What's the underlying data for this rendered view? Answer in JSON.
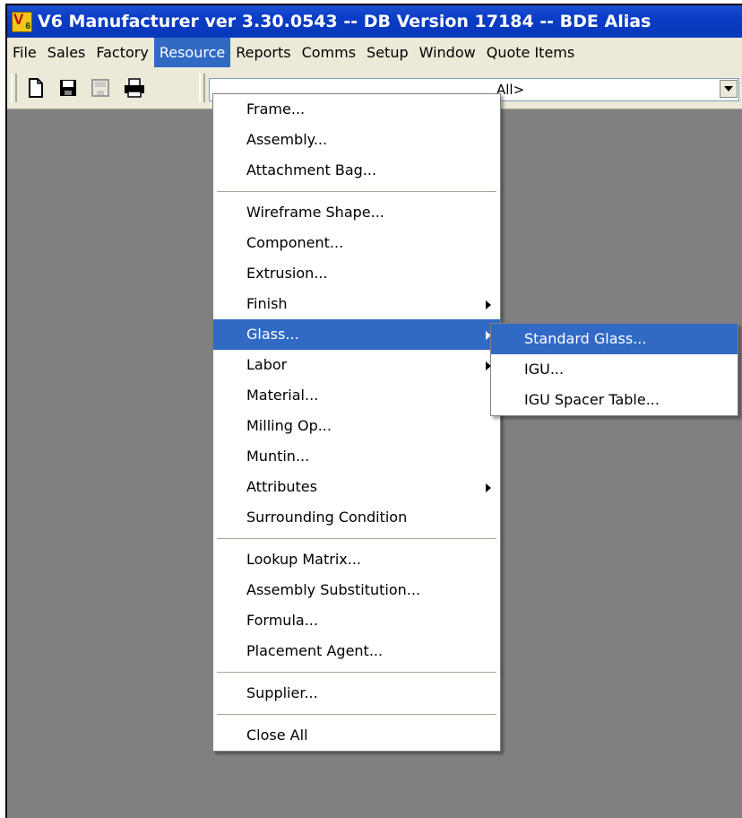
{
  "window": {
    "title": "V6 Manufacturer ver 3.30.0543 -- DB Version 17184 -- BDE Alias"
  },
  "menubar": {
    "items": [
      {
        "label": "File"
      },
      {
        "label": "Sales"
      },
      {
        "label": "Factory"
      },
      {
        "label": "Resource",
        "active": true
      },
      {
        "label": "Reports"
      },
      {
        "label": "Comms"
      },
      {
        "label": "Setup"
      },
      {
        "label": "Window"
      },
      {
        "label": "Quote Items"
      }
    ]
  },
  "toolbar": {
    "icons": [
      "new-document-icon",
      "save-icon",
      "save-all-icon",
      "print-icon"
    ],
    "combo_value": "All>"
  },
  "resource_menu": {
    "items": [
      "Frame...",
      "Assembly...",
      "Attachment Bag...",
      "Wireframe Shape...",
      "Component...",
      "Extrusion...",
      "Finish",
      "Glass...",
      "Labor",
      "Material...",
      "Milling Op...",
      "Muntin...",
      "Attributes",
      "Surrounding Condition",
      "Lookup Matrix...",
      "Assembly Substitution...",
      "Formula...",
      "Placement Agent...",
      "Supplier...",
      "Close All"
    ]
  },
  "glass_submenu": {
    "items": [
      "Standard Glass...",
      "IGU...",
      "IGU Spacer Table..."
    ]
  },
  "colors": {
    "titlebar": "#0a3cc6",
    "highlight": "#316ac5",
    "menubar": "#ece9d8",
    "workspace": "#808080"
  }
}
